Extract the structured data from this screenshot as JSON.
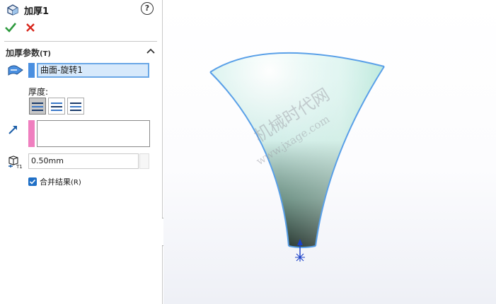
{
  "feature": {
    "title": "加厚1",
    "help": "?"
  },
  "section": {
    "title": "加厚参数",
    "hotkey": "(T)"
  },
  "selection": {
    "item": "曲面-旋转1"
  },
  "thickness": {
    "label": "厚度:",
    "value": "0.50mm"
  },
  "merge": {
    "label": "合并结果",
    "hotkey": "(R)",
    "checked": true
  },
  "watermark": {
    "line1": "机械时代网",
    "line2": "www.jxage.com"
  },
  "colors": {
    "selection_blue": "#4a8fe0",
    "selection_pink": "#ef7fbf",
    "edge": "#5aa0e8",
    "ok_green": "#2e9a3e",
    "cancel_red": "#d8261c"
  },
  "icons": {
    "title": "thicken-feature-icon",
    "ok": "checkmark-icon",
    "cancel": "x-icon",
    "collapse": "chevron-up-icon",
    "surface": "surface-selection-icon",
    "direction": "direction-arrow-icon",
    "thickness": "thickness-t1-icon",
    "origin": "coordinate-triad-icon"
  }
}
